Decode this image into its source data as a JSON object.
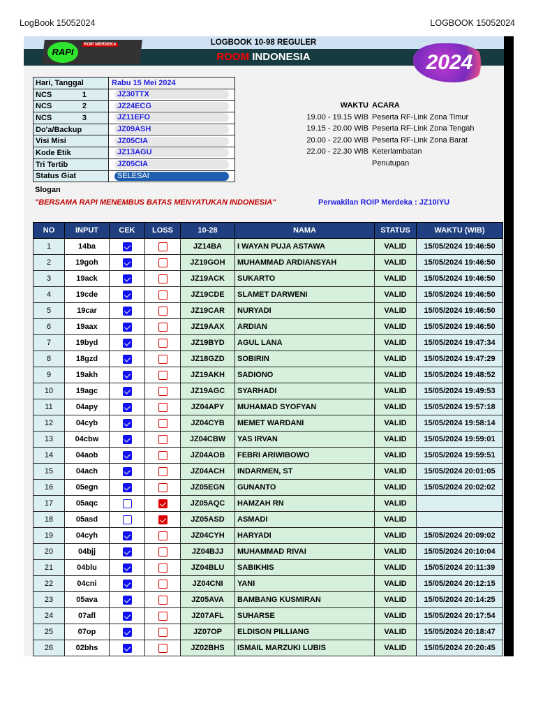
{
  "page_header": {
    "left": "LogBook 15052024",
    "right": "LOGBOOK 15052024"
  },
  "banner": {
    "title": "LOGBOOK 10-98 REGULER",
    "room_red": "ROOM",
    "room_white": "INDONESIA",
    "logo_text": "RAPI",
    "logo_sub": "ROIP MERDEKA",
    "year_badge": "2024"
  },
  "info": [
    {
      "label": "Hari, Tanggal",
      "value": "Rabu 15 Mei 2024",
      "num": ""
    },
    {
      "label": "NCS",
      "num": "1",
      "value": "JZ30TTX"
    },
    {
      "label": "NCS",
      "num": "2",
      "value": "JZ24ECG"
    },
    {
      "label": "NCS",
      "num": "3",
      "value": "JZ11EFO"
    },
    {
      "label": "Do'a/Backup",
      "num": "",
      "value": "JZ09ASH"
    },
    {
      "label": "Visi Misi",
      "num": "",
      "value": "JZ05CIA"
    },
    {
      "label": "Kode Etik",
      "num": "",
      "value": "JZ13AGU"
    },
    {
      "label": "Tri Tertib",
      "num": "",
      "value": "JZ05CIA"
    },
    {
      "label": "Status Giat",
      "num": "",
      "value": "SELESAI"
    }
  ],
  "schedule": {
    "head_waktu": "WAKTU",
    "head_acara": "ACARA",
    "rows": [
      {
        "waktu": "19.00 - 19.15 WIB",
        "acara": "Peserta RF-Link Zona Timur"
      },
      {
        "waktu": "19.15 - 20.00 WIB",
        "acara": "Peserta RF-Link Zona Tengah"
      },
      {
        "waktu": "20.00 - 22.00 WIB",
        "acara": "Peserta RF-Link Zona Barat"
      },
      {
        "waktu": "22.00 - 22.30 WIB",
        "acara": "Keterlambatan"
      },
      {
        "waktu": "",
        "acara": "Penutupan"
      }
    ]
  },
  "slogan_label": "Slogan",
  "slogan": "\"BERSAMA RAPI MENEMBUS BATAS MENYATUKAN INDONESIA\"",
  "perwakilan": "Perwakilan ROIP Merdeka  : JZ10IYU",
  "columns": [
    "NO",
    "INPUT",
    "CEK",
    "LOSS",
    "10-28",
    "NAMA",
    "STATUS",
    "WAKTU (WIB)"
  ],
  "rows": [
    [
      "1",
      "14ba",
      true,
      false,
      "JZ14BA",
      "I WAYAN PUJA ASTAWA",
      "VALID",
      "15/05/2024 19:46:50"
    ],
    [
      "2",
      "19goh",
      true,
      false,
      "JZ19GOH",
      "MUHAMMAD ARDIANSYAH",
      "VALID",
      "15/05/2024 19:46:50"
    ],
    [
      "3",
      "19ack",
      true,
      false,
      "JZ19ACK",
      "SUKARTO",
      "VALID",
      "15/05/2024 19:46:50"
    ],
    [
      "4",
      "19cde",
      true,
      false,
      "JZ19CDE",
      "SLAMET DARWENI",
      "VALID",
      "15/05/2024 19:46:50"
    ],
    [
      "5",
      "19car",
      true,
      false,
      "JZ19CAR",
      "NURYADI",
      "VALID",
      "15/05/2024 19:46:50"
    ],
    [
      "6",
      "19aax",
      true,
      false,
      "JZ19AAX",
      "ARDIAN",
      "VALID",
      "15/05/2024 19:46:50"
    ],
    [
      "7",
      "19byd",
      true,
      false,
      "JZ19BYD",
      "AGUL LANA",
      "VALID",
      "15/05/2024 19:47:34"
    ],
    [
      "8",
      "18gzd",
      true,
      false,
      "JZ18GZD",
      "SOBIRIN",
      "VALID",
      "15/05/2024 19:47:29"
    ],
    [
      "9",
      "19akh",
      true,
      false,
      "JZ19AKH",
      "SADIONO",
      "VALID",
      "15/05/2024 19:48:52"
    ],
    [
      "10",
      "19agc",
      true,
      false,
      "JZ19AGC",
      "SYARHADI",
      "VALID",
      "15/05/2024 19:49:53"
    ],
    [
      "11",
      "04apy",
      true,
      false,
      "JZ04APY",
      "MUHAMAD SYOFYAN",
      "VALID",
      "15/05/2024 19:57:18"
    ],
    [
      "12",
      "04cyb",
      true,
      false,
      "JZ04CYB",
      "MEMET WARDANI",
      "VALID",
      "15/05/2024 19:58:14"
    ],
    [
      "13",
      "04cbw",
      true,
      false,
      "JZ04CBW",
      "YAS IRVAN",
      "VALID",
      "15/05/2024 19:59:01"
    ],
    [
      "14",
      "04aob",
      true,
      false,
      "JZ04AOB",
      "FEBRI ARIWIBOWO",
      "VALID",
      "15/05/2024 19:59:51"
    ],
    [
      "15",
      "04ach",
      true,
      false,
      "JZ04ACH",
      "INDARMEN, ST",
      "VALID",
      "15/05/2024 20:01:05"
    ],
    [
      "16",
      "05egn",
      true,
      false,
      "JZ05EGN",
      "GUNANTO",
      "VALID",
      "15/05/2024 20:02:02"
    ],
    [
      "17",
      "05aqc",
      false,
      true,
      "JZ05AQC",
      "HAMZAH RN",
      "VALID",
      ""
    ],
    [
      "18",
      "05asd",
      false,
      true,
      "JZ05ASD",
      "ASMADI",
      "VALID",
      ""
    ],
    [
      "19",
      "04cyh",
      true,
      false,
      "JZ04CYH",
      "HARYADI",
      "VALID",
      "15/05/2024 20:09:02"
    ],
    [
      "20",
      "04bjj",
      true,
      false,
      "JZ04BJJ",
      "MUHAMMAD RIVAI",
      "VALID",
      "15/05/2024 20:10:04"
    ],
    [
      "21",
      "04blu",
      true,
      false,
      "JZ04BLU",
      "SABIKHIS",
      "VALID",
      "15/05/2024 20:11:39"
    ],
    [
      "22",
      "04cni",
      true,
      false,
      "JZ04CNI",
      "YANI",
      "VALID",
      "15/05/2024 20:12:15"
    ],
    [
      "23",
      "05ava",
      true,
      false,
      "JZ05AVA",
      "BAMBANG KUSMIRAN",
      "VALID",
      "15/05/2024 20:14:25"
    ],
    [
      "24",
      "07afl",
      true,
      false,
      "JZ07AFL",
      "SUHARSE",
      "VALID",
      "15/05/2024 20:17:54"
    ],
    [
      "25",
      "07op",
      true,
      false,
      "JZ07OP",
      "ELDISON PILLIANG",
      "VALID",
      "15/05/2024 20:18:47"
    ],
    [
      "26",
      "02bhs",
      true,
      false,
      "JZ02BHS",
      "ISMAIL MARZUKI LUBIS",
      "VALID",
      "15/05/2024 20:20:45"
    ]
  ]
}
